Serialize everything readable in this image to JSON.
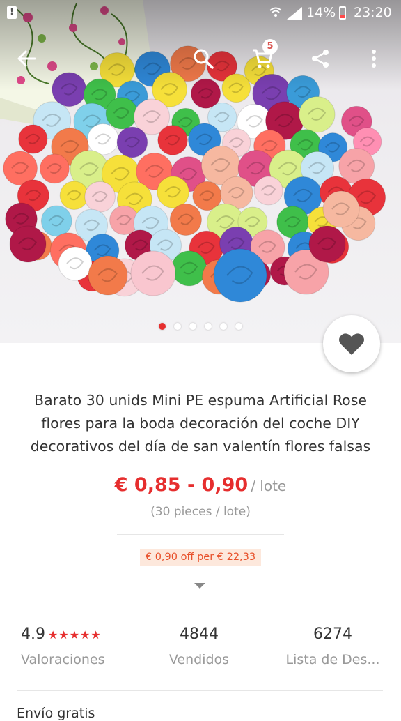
{
  "status_bar": {
    "battery": "14%",
    "time": "23:20"
  },
  "toolbar": {
    "back_icon": "arrow-left-icon",
    "search_icon": "magnifier-icon",
    "cart_icon": "shopping-cart-icon",
    "cart_count": "5",
    "share_icon": "share-icon",
    "more_icon": "vertical-dots-icon"
  },
  "gallery": {
    "image_count": 6,
    "active_index": 0
  },
  "product": {
    "title": "Barato 30 unids Mini PE espuma Artificial Rose flores para la boda decoración del coche DIY decorativos del día de san valentín flores falsas",
    "price": "€ 0,85 - 0,90",
    "price_unit": "/ lote",
    "pieces": "(30 pieces / lote)",
    "coupon": "€ 0,90 off per € 22,33"
  },
  "stats": {
    "rating_value": "4.9",
    "rating_stars": "★★★★★",
    "rating_label": "Valoraciones",
    "sold_value": "4844",
    "sold_label": "Vendidos",
    "wish_value": "6274",
    "wish_label": "Lista de Des..."
  },
  "shipping_label": "Envío gratis",
  "colors": {
    "accent": "#e62e2e",
    "coupon_bg": "#fde8dc",
    "coupon_text": "#e8502a"
  }
}
